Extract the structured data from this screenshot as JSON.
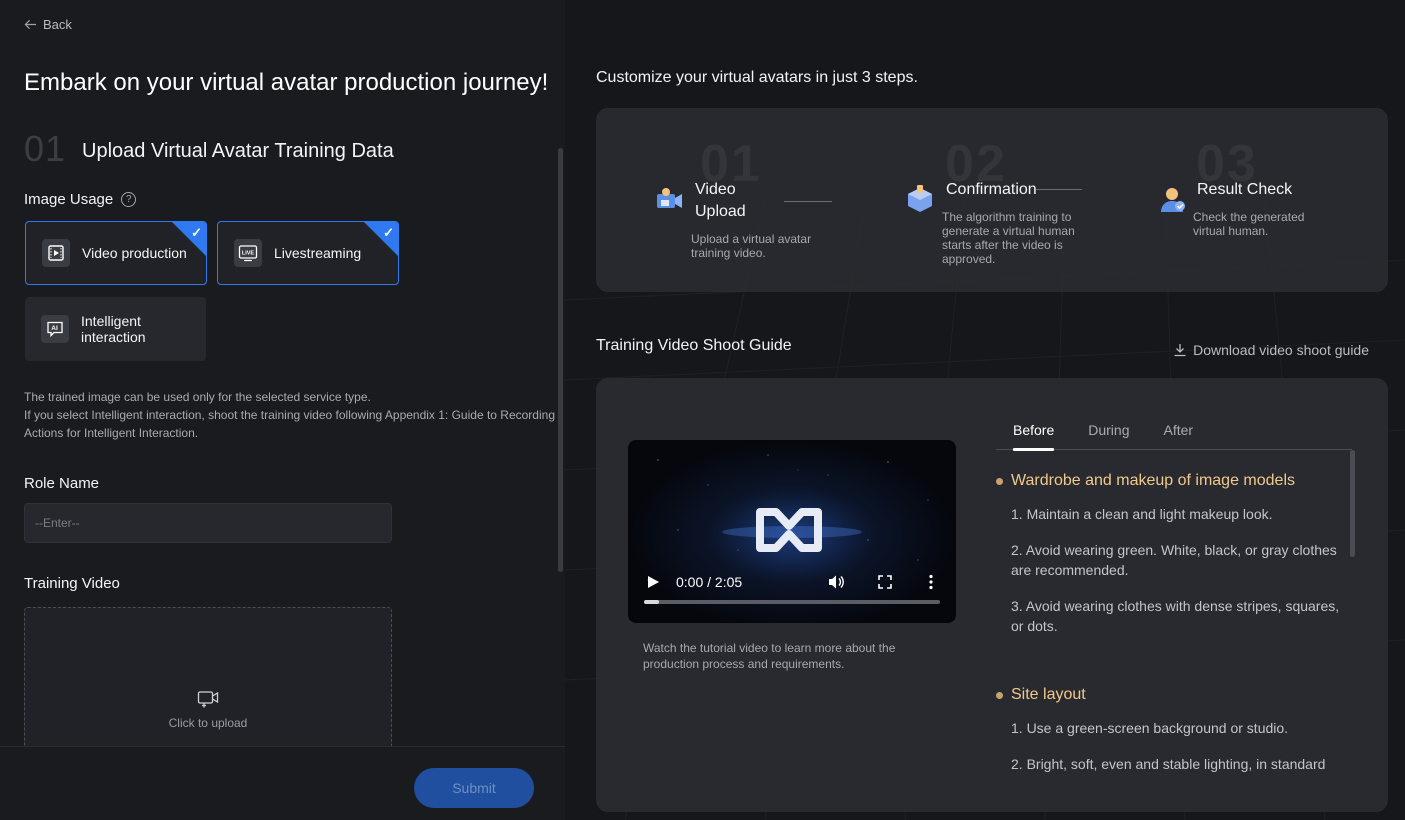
{
  "nav": {
    "back_label": "Back"
  },
  "left": {
    "page_title": "Embark on your virtual avatar production journey!",
    "step_number": "01",
    "step_title": "Upload Virtual Avatar Training Data",
    "image_usage_label": "Image Usage",
    "usage_options": [
      {
        "label": "Video production",
        "selected": true,
        "icon": "film-icon"
      },
      {
        "label": "Livestreaming",
        "selected": true,
        "icon": "live-icon"
      },
      {
        "label": "Intelligent interaction",
        "selected": false,
        "icon": "ai-chat-icon"
      }
    ],
    "hint_line1": "The trained image can be used only for the selected service type.",
    "hint_line2": "If you select Intelligent interaction, shoot the training video following Appendix 1: Guide to Recording Actions for Intelligent Interaction.",
    "role_name_label": "Role Name",
    "role_name_placeholder": "--Enter--",
    "role_name_value": "",
    "training_video_label": "Training Video",
    "upload_text": "Click to upload",
    "submit_label": "Submit"
  },
  "right": {
    "title": "Customize your virtual avatars in just 3 steps.",
    "steps": [
      {
        "num": "01",
        "title": "Video Upload",
        "desc": "Upload a virtual avatar training video.",
        "icon": "video-upload-icon"
      },
      {
        "num": "02",
        "title": "Confirmation",
        "desc": "The algorithm training to generate a virtual human starts after the video is approved.",
        "icon": "confirmation-icon"
      },
      {
        "num": "03",
        "title": "Result Check",
        "desc": "Check the generated virtual human.",
        "icon": "result-check-icon"
      }
    ],
    "guide_title": "Training Video Shoot Guide",
    "download_label": "Download video shoot guide",
    "video_time": "0:00 / 2:05",
    "video_progress": 0.05,
    "video_caption": "Watch the tutorial video to learn more about the production process and requirements.",
    "tabs": [
      "Before",
      "During",
      "After"
    ],
    "active_tab": "Before",
    "sections": [
      {
        "title": "Wardrobe and makeup of image models",
        "items": [
          "1. Maintain a clean and light makeup look.",
          "2. Avoid wearing green. White, black, or gray clothes are recommended.",
          "3. Avoid wearing clothes with dense stripes, squares, or dots."
        ]
      },
      {
        "title": "Site layout",
        "items": [
          "1. Use a green-screen background or studio.",
          "2. Bright, soft, even and stable lighting, in standard"
        ]
      }
    ],
    "colors": {
      "accent": "#2f7af0",
      "section_title": "#f0c98c",
      "submit_bg": "#1f4f9e"
    }
  }
}
